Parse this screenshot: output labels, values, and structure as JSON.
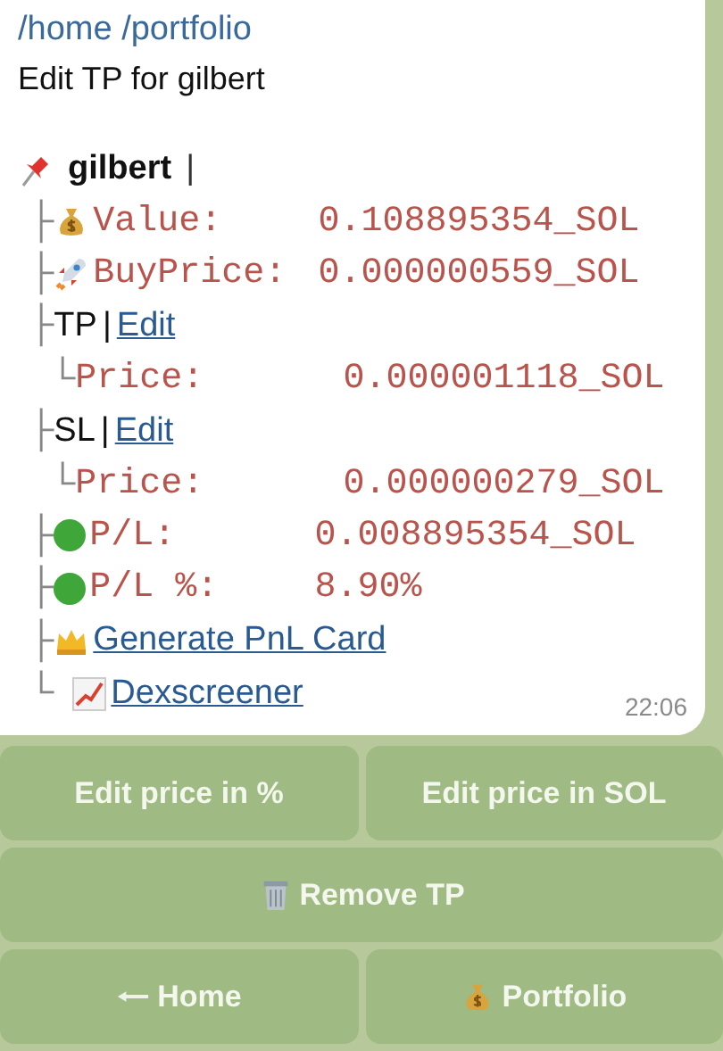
{
  "message": {
    "path_link": "/home /portfolio",
    "title": "Edit TP for gilbert",
    "token": {
      "name": "gilbert",
      "separator": "|"
    },
    "rows": [
      {
        "kind": "field",
        "prefix": "├",
        "label": "Value:",
        "value": "0.108895354_SOL"
      },
      {
        "kind": "field",
        "prefix": "├",
        "label": "BuyPrice:",
        "value": "0.000000559_SOL"
      },
      {
        "kind": "section",
        "prefix": "├",
        "label": "TP",
        "separator": "|",
        "link": "Edit"
      },
      {
        "kind": "subfield",
        "prefix": "└",
        "label": "Price:",
        "value": "0.000001118_SOL"
      },
      {
        "kind": "section",
        "prefix": "├",
        "label": "SL",
        "separator": "|",
        "link": "Edit"
      },
      {
        "kind": "subfield",
        "prefix": "└",
        "label": "Price:",
        "value": "0.000000279_SOL"
      },
      {
        "kind": "field",
        "prefix": "├",
        "label": "P/L:",
        "value": "0.008895354_SOL",
        "color": "#3fa63a"
      },
      {
        "kind": "field",
        "prefix": "├",
        "label": "P/L %:",
        "value": "8.90%",
        "color": "#3fa63a"
      },
      {
        "kind": "link",
        "prefix": "├",
        "link": "Generate PnL Card"
      },
      {
        "kind": "link",
        "prefix": "└",
        "link": "Dexscreener"
      }
    ],
    "time": "22:06"
  },
  "keyboard": [
    [
      {
        "label": "Edit price in %"
      },
      {
        "label": "Edit price in SOL"
      }
    ],
    [
      {
        "label": "Remove TP"
      }
    ],
    [
      {
        "label": "Home"
      },
      {
        "label": "Portfolio"
      }
    ]
  ]
}
